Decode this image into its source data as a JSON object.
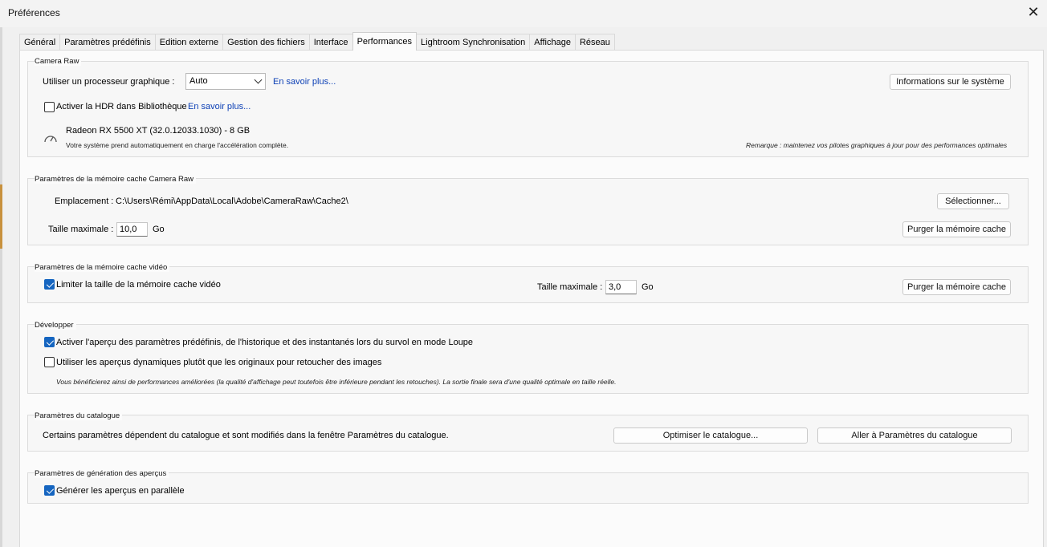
{
  "window": {
    "title": "Préférences"
  },
  "tabs": [
    {
      "label": "Général"
    },
    {
      "label": "Paramètres prédéfinis"
    },
    {
      "label": "Edition externe"
    },
    {
      "label": "Gestion des fichiers"
    },
    {
      "label": "Interface"
    },
    {
      "label": "Performances",
      "active": true
    },
    {
      "label": "Lightroom Synchronisation"
    },
    {
      "label": "Affichage"
    },
    {
      "label": "Réseau"
    }
  ],
  "camera_raw": {
    "title": "Camera Raw",
    "gpu_label": "Utiliser un processeur graphique :",
    "gpu_value": "Auto",
    "learn_more": "En savoir plus...",
    "system_info_button": "Informations sur le système",
    "hdr_label": "Activer la HDR dans Bibliothèque",
    "hdr_checked": false,
    "hdr_learn_more": "En savoir plus...",
    "gpu_name": "Radeon RX 5500 XT (32.0.12033.1030) - 8 GB",
    "gpu_status": "Votre système prend automatiquement en charge l'accélération complète.",
    "remark": "Remarque : maintenez vos pilotes graphiques à jour pour des performances optimales"
  },
  "cache": {
    "title": "Paramètres de la mémoire cache Camera Raw",
    "location_label": "Emplacement :",
    "location_value": "C:\\Users\\Rémi\\AppData\\Local\\Adobe\\CameraRaw\\Cache2\\",
    "select_button": "Sélectionner...",
    "max_size_label": "Taille maximale :",
    "max_size_value": "10,0",
    "unit": "Go",
    "purge_button": "Purger la mémoire cache"
  },
  "video_cache": {
    "title": "Paramètres de la mémoire cache vidéo",
    "limit_label": "Limiter la taille de la mémoire cache vidéo",
    "limit_checked": true,
    "max_size_label": "Taille maximale :",
    "max_size_value": "3,0",
    "unit": "Go",
    "purge_button": "Purger la mémoire cache"
  },
  "develop": {
    "title": "Développer",
    "preview_label": "Activer l'aperçu des paramètres prédéfinis, de l'historique et des instantanés lors du survol en mode Loupe",
    "preview_checked": true,
    "smart_label": "Utiliser les aperçus dynamiques plutôt que les originaux pour retoucher des images",
    "smart_checked": false,
    "note": "Vous bénéficierez ainsi de performances améliorées (la qualité d'affichage peut toutefois être inférieure pendant les retouches). La sortie finale sera d'une qualité optimale en taille réelle."
  },
  "catalog": {
    "title": "Paramètres du catalogue",
    "description": "Certains paramètres dépendent du catalogue et sont modifiés dans la fenêtre Paramètres du catalogue.",
    "optimize_button": "Optimiser le catalogue...",
    "goto_button": "Aller à Paramètres du catalogue"
  },
  "previews": {
    "title": "Paramètres de génération des aperçus",
    "parallel_label": "Générer les aperçus en parallèle",
    "parallel_checked": true
  },
  "colors": {
    "accent": "#1565c0",
    "link": "#0b3fb5"
  }
}
